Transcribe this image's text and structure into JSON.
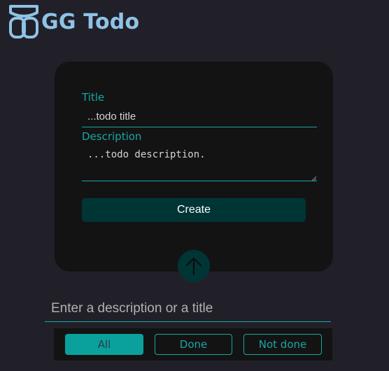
{
  "app": {
    "title": "GG Todo",
    "logo_icon": "logo-icon"
  },
  "form": {
    "title_label": "Title",
    "title_placeholder": "...todo title",
    "description_label": "Description",
    "description_placeholder": "...todo description.",
    "create_label": "Create",
    "scroll_icon": "arrow-up-icon"
  },
  "search": {
    "placeholder": "Enter a description or a title"
  },
  "filters": [
    {
      "label": "All",
      "active": true
    },
    {
      "label": "Done",
      "active": false
    },
    {
      "label": "Not done",
      "active": false
    }
  ],
  "colors": {
    "background": "#212029",
    "card": "#131314",
    "accent": "#1aa5a2",
    "button_dark": "#003535",
    "title": "#8fc3e6"
  }
}
